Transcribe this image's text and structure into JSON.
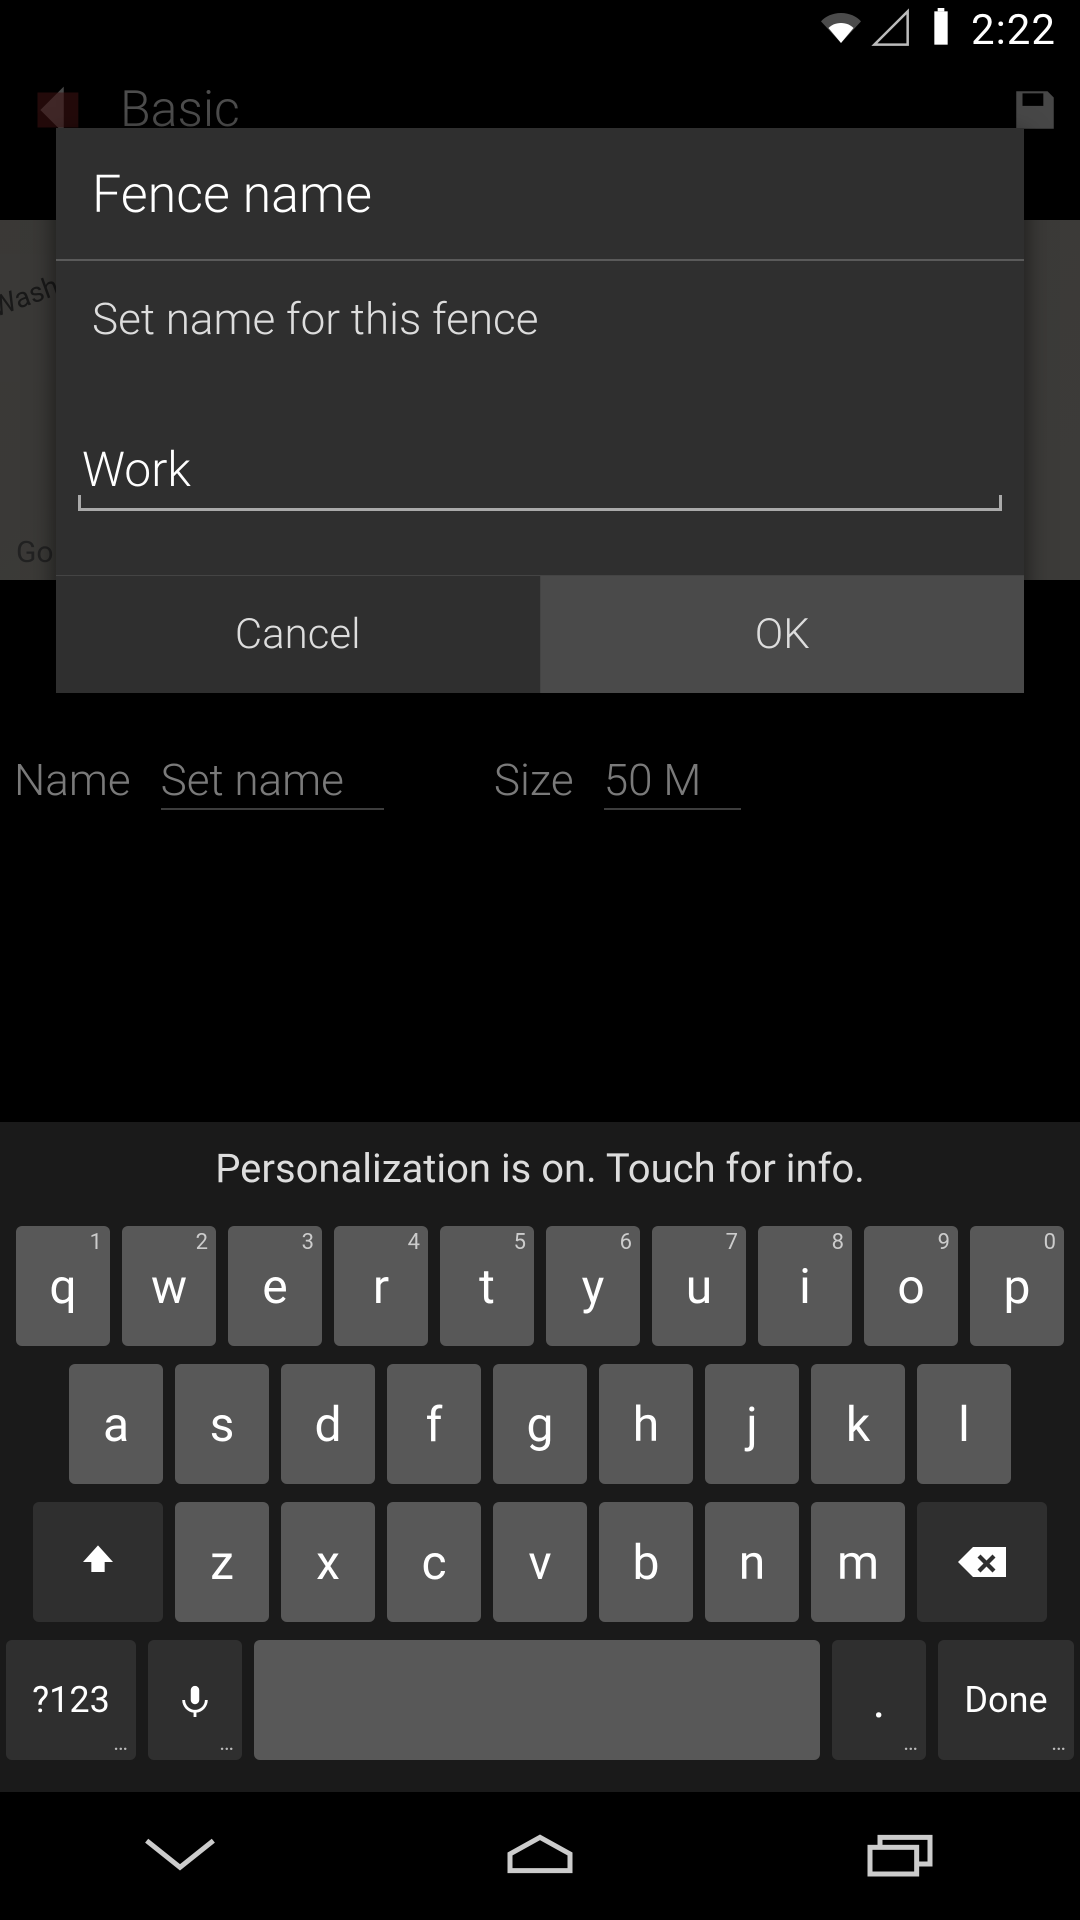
{
  "status": {
    "time": "2:22"
  },
  "header": {
    "title": "Basic"
  },
  "background_map": {
    "label_top": "Wash",
    "label_bottom": "Go"
  },
  "fields": {
    "name_label": "Name",
    "name_value": "Set name",
    "size_label": "Size",
    "size_value": "50 M"
  },
  "dialog": {
    "title": "Fence name",
    "message": "Set name for this fence",
    "input_value": "Work",
    "cancel": "Cancel",
    "ok": "OK"
  },
  "keyboard": {
    "suggestion": "Personalization is on. Touch for info.",
    "row1": [
      {
        "k": "q",
        "h": "1"
      },
      {
        "k": "w",
        "h": "2"
      },
      {
        "k": "e",
        "h": "3"
      },
      {
        "k": "r",
        "h": "4"
      },
      {
        "k": "t",
        "h": "5"
      },
      {
        "k": "y",
        "h": "6"
      },
      {
        "k": "u",
        "h": "7"
      },
      {
        "k": "i",
        "h": "8"
      },
      {
        "k": "o",
        "h": "9"
      },
      {
        "k": "p",
        "h": "0"
      }
    ],
    "row2": [
      "a",
      "s",
      "d",
      "f",
      "g",
      "h",
      "j",
      "k",
      "l"
    ],
    "row3": [
      "z",
      "x",
      "c",
      "v",
      "b",
      "n",
      "m"
    ],
    "sym": "?123",
    "dot": ".",
    "done": "Done"
  }
}
